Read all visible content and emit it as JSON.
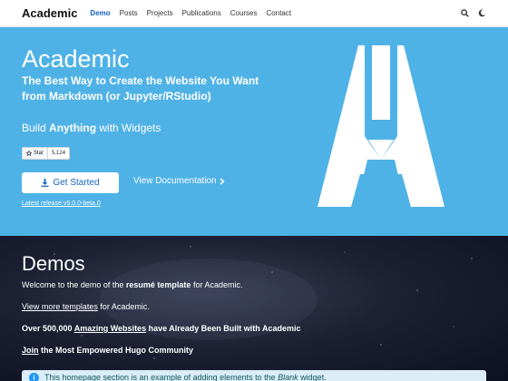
{
  "navbar": {
    "brand": "Academic",
    "links": [
      "Demo",
      "Posts",
      "Projects",
      "Publications",
      "Courses",
      "Contact"
    ],
    "active": "Demo",
    "icons": [
      "search-icon",
      "moon-icon"
    ]
  },
  "hero": {
    "title": "Academic",
    "lead": "The Best Way to Create the Website You Want from Markdown (or Jupyter/RStudio)",
    "sub_prefix": "Build ",
    "sub_bold": "Anything",
    "sub_suffix": " with Widgets",
    "github": {
      "star_label": "Star",
      "count": "5,124"
    },
    "get_started": "Get Started",
    "view_docs": "View Documentation",
    "release": "Latest release v5.0.0-beta.0",
    "colors": {
      "background": "#4fb2e6",
      "button_text": "#1565c0"
    }
  },
  "demos": {
    "title": "Demos",
    "line1_prefix": "Welcome to the demo of the ",
    "line1_bold": "resumé template",
    "line1_suffix": " for Academic.",
    "line2_link": "View more templates",
    "line2_suffix": " for Academic.",
    "line3_prefix": "Over 500,000 ",
    "line3_link": "Amazing Websites",
    "line3_suffix": " have Already Been Built with Academic",
    "line4_link": "Join",
    "line4_suffix": " the Most Empowered Hugo Community",
    "alert_prefix": "This homepage section is an example of adding elements to the ",
    "alert_em": "Blank",
    "alert_suffix": " widget."
  }
}
